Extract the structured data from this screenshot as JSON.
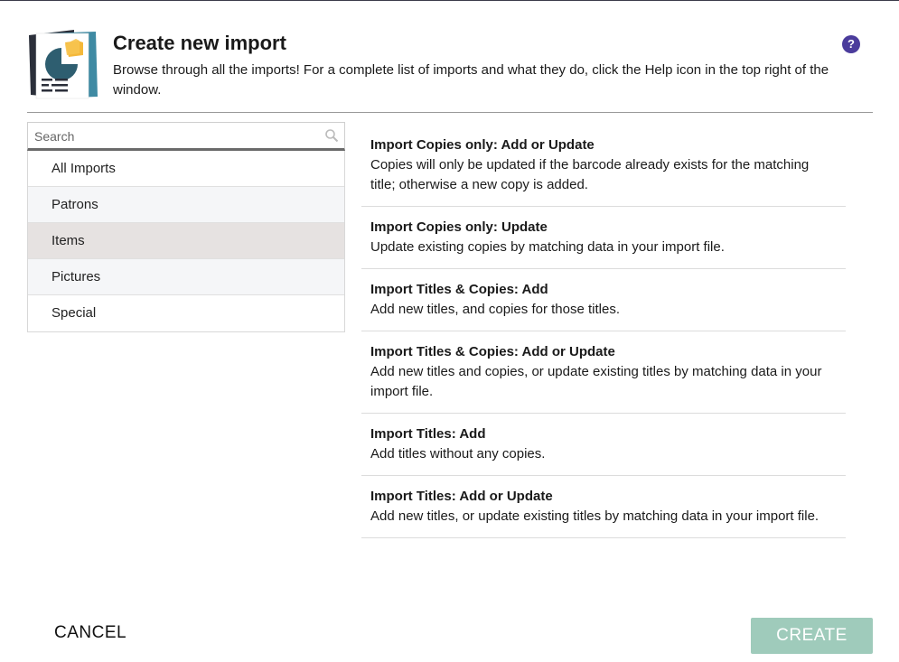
{
  "header": {
    "title": "Create new import",
    "subtitle": "Browse through all the imports! For a complete list of imports and what they do, click the Help icon in the top right of the window.",
    "help_label": "?"
  },
  "search": {
    "placeholder": "Search",
    "value": ""
  },
  "categories": [
    {
      "label": "All Imports",
      "state": "normal"
    },
    {
      "label": "Patrons",
      "state": "normal"
    },
    {
      "label": "Items",
      "state": "selected"
    },
    {
      "label": "Pictures",
      "state": "normal"
    },
    {
      "label": "Special",
      "state": "normal"
    }
  ],
  "imports": [
    {
      "title": "Import Copies only: Add or Update",
      "desc": "Copies will only be updated if the barcode already exists for the matching title; otherwise a new copy is added."
    },
    {
      "title": "Import Copies only: Update",
      "desc": "Update existing copies by matching data in your import file."
    },
    {
      "title": "Import Titles & Copies: Add",
      "desc": "Add new titles, and copies for those titles."
    },
    {
      "title": "Import Titles & Copies: Add or Update",
      "desc": "Add new titles and copies, or update existing titles by matching data in your import file."
    },
    {
      "title": "Import Titles: Add",
      "desc": "Add titles without any copies."
    },
    {
      "title": "Import Titles: Add or Update",
      "desc": "Add new titles, or update existing titles by matching data in your import file."
    }
  ],
  "footer": {
    "cancel_label": "CANCEL",
    "create_label": "CREATE"
  },
  "colors": {
    "accent": "#4b3c9c",
    "create_button": "#9fcbbb",
    "selected_row": "#e6e2e1"
  }
}
